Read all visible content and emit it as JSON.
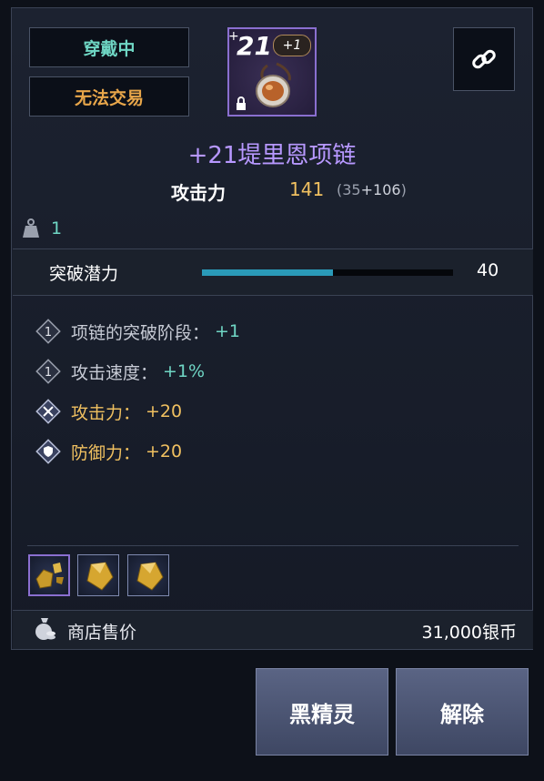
{
  "status": {
    "equipped": "穿戴中",
    "untradable": "无法交易"
  },
  "item": {
    "enhance_level": "21",
    "enhance_plus": "+",
    "bonus_badge": "+1",
    "name": "+21堤里恩项链",
    "icon": "amulet-icon",
    "rarity_color": "#8a6fd0"
  },
  "attack": {
    "label": "攻击力",
    "value": "141",
    "breakdown_open": "(35",
    "breakdown_bonus": "+106",
    "breakdown_close": ")"
  },
  "weight": {
    "value": "1",
    "icon": "weight-icon"
  },
  "potential": {
    "label": "突破潜力",
    "value": "40",
    "fill_fraction": 0.52
  },
  "stats": [
    {
      "icon": "rank-1-diamond-icon",
      "label": "项链的突破阶段：",
      "value": "+1",
      "label_color": "#c8ccd6",
      "value_color": "#6fd6c4"
    },
    {
      "icon": "rank-1-diamond-icon",
      "label": "攻击速度：",
      "value": "+1%",
      "label_color": "#c8ccd6",
      "value_color": "#6fd6c4"
    },
    {
      "icon": "crossed-swords-diamond-icon",
      "label": "攻击力：",
      "value": "+20",
      "label_color": "#f0c060",
      "value_color": "#f0c060"
    },
    {
      "icon": "shield-diamond-icon",
      "label": "防御力：",
      "value": "+20",
      "label_color": "#f0c060",
      "value_color": "#f0c060"
    }
  ],
  "gems": [
    {
      "icon": "gold-crystal-cluster-icon",
      "selected": true
    },
    {
      "icon": "gold-crystal-icon",
      "selected": false
    },
    {
      "icon": "gold-crystal-icon",
      "selected": false
    }
  ],
  "shop": {
    "label": "商店售价",
    "price": "31,000银币",
    "icon": "money-bag-icon"
  },
  "buttons": {
    "dark_elf": "黑精灵",
    "remove": "解除"
  }
}
